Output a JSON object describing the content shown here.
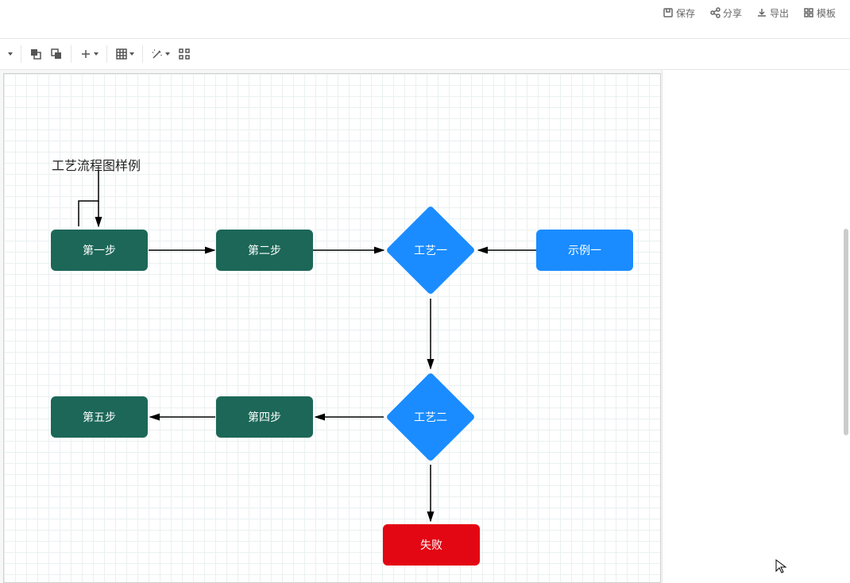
{
  "topmenu": {
    "save": "保存",
    "share": "分享",
    "export": "导出",
    "template": "模板"
  },
  "diagram": {
    "title": "工艺流程图样例",
    "nodes": {
      "step1": "第一步",
      "step2": "第二步",
      "process1": "工艺一",
      "example1": "示例一",
      "process2": "工艺二",
      "step4": "第四步",
      "step5": "第五步",
      "fail": "失败"
    }
  }
}
